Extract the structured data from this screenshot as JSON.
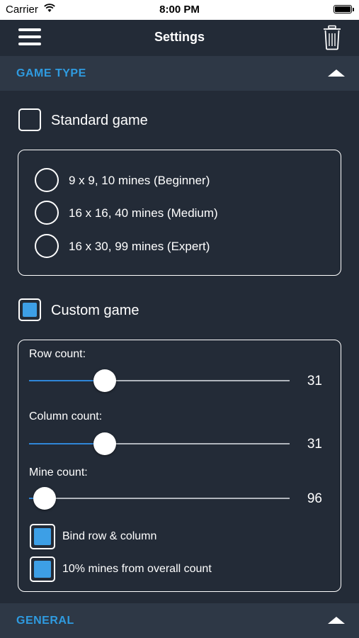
{
  "status_bar": {
    "carrier": "Carrier",
    "time": "8:00 PM"
  },
  "nav": {
    "title": "Settings"
  },
  "game_type": {
    "header": "GAME TYPE",
    "standard": {
      "label": "Standard game",
      "checked": false
    },
    "presets": [
      {
        "label": "9 x 9, 10 mines (Beginner)"
      },
      {
        "label": "16 x 16, 40 mines (Medium)"
      },
      {
        "label": "16 x 30, 99 mines (Expert)"
      }
    ],
    "custom": {
      "label": "Custom game",
      "checked": true
    },
    "sliders": [
      {
        "label": "Row count:",
        "value": "31",
        "fraction": 0.29
      },
      {
        "label": "Column count:",
        "value": "31",
        "fraction": 0.29
      },
      {
        "label": "Mine count:",
        "value": "96",
        "fraction": 0.06
      }
    ],
    "options": [
      {
        "label": "Bind row & column",
        "checked": true
      },
      {
        "label": "10% mines from overall count",
        "checked": true
      }
    ]
  },
  "general": {
    "header": "GENERAL"
  },
  "colors": {
    "accent": "#2f9be0",
    "background": "#232b37",
    "section": "#2e3846",
    "check_fill": "#3d9fe6"
  }
}
